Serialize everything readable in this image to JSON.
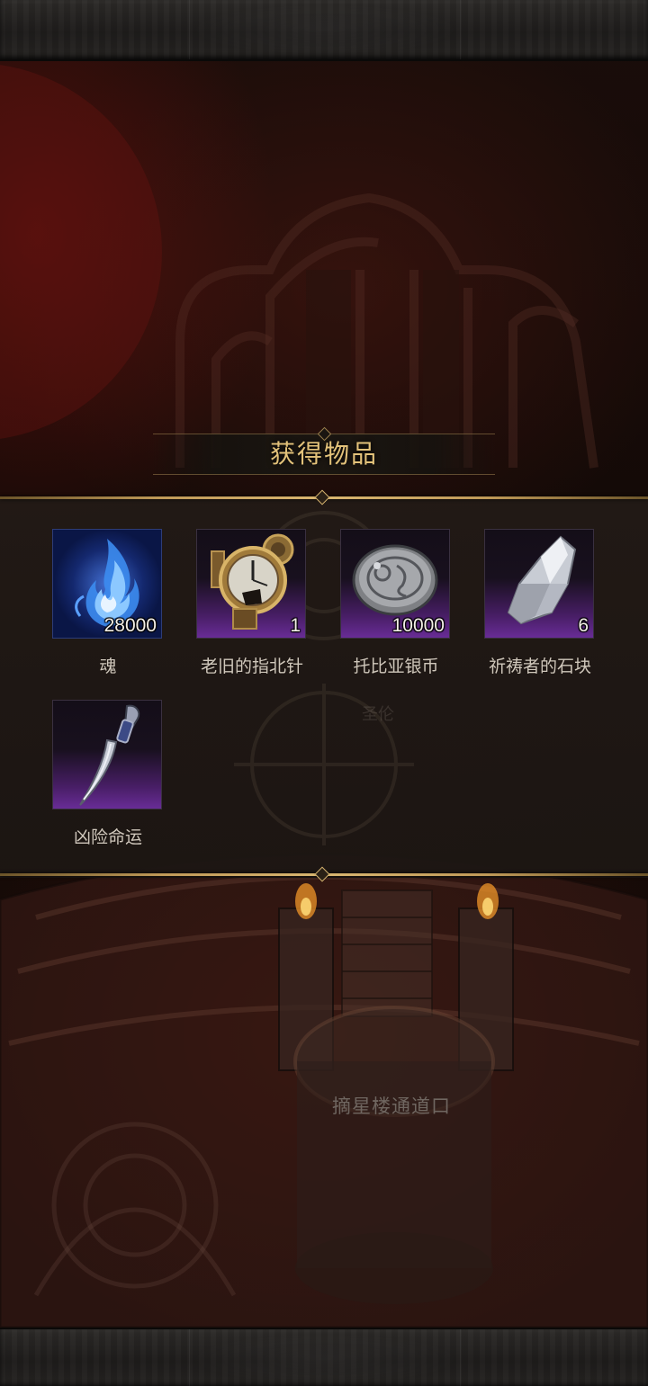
{
  "panel": {
    "title": "获得物品"
  },
  "items": [
    {
      "name": "魂",
      "quantity": "28000",
      "icon": "blue-soul-flame-icon",
      "rarity_color": "#2f56c8"
    },
    {
      "name": "老旧的指北针",
      "quantity": "1",
      "icon": "old-brass-compass-icon",
      "rarity_color": "#6a2c96"
    },
    {
      "name": "托比亚银币",
      "quantity": "10000",
      "icon": "silver-coin-icon",
      "rarity_color": "#6a2c96"
    },
    {
      "name": "祈祷者的石块",
      "quantity": "6",
      "icon": "white-crystal-stone-icon",
      "rarity_color": "#6a2c96"
    },
    {
      "name": "凶险命运",
      "quantity": "",
      "icon": "curved-dagger-icon",
      "rarity_color": "#6a2c96"
    }
  ],
  "scene": {
    "location_label": "摘星楼通道口",
    "faint_label": "圣伦"
  },
  "colors": {
    "title_gold": "#e3c27a",
    "frame_gold": "#c09a58",
    "panel_bg": "#221a16"
  }
}
